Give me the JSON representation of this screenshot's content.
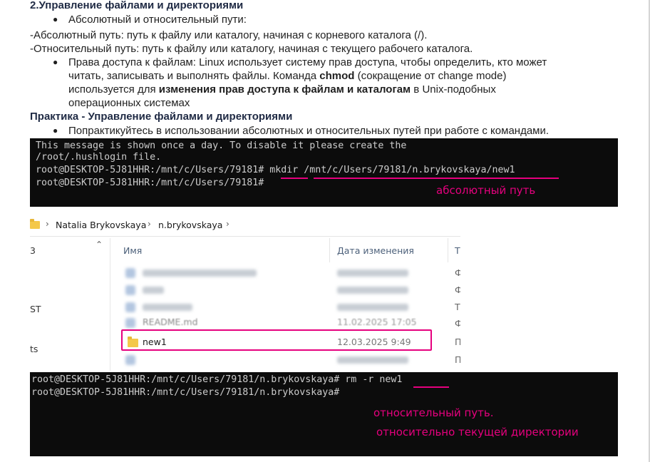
{
  "doc": {
    "h_section": "2.Управление файлами и директориями",
    "b1": "Абсолютный и относительный пути:",
    "p_abs": "-Абсолютный путь: путь к файлу или каталогу, начиная с корневого каталога (/).",
    "p_rel": "-Относительный путь: путь к файлу или каталогу, начиная с текущего рабочего каталога.",
    "b2_line1": "Права доступа к файлам: Linux использует систему прав доступа, чтобы определить, кто может",
    "b2_line2_a": "читать, записывать и выполнять файлы. Команда ",
    "b2_line2_b": "chmod",
    "b2_line2_c": " (сокращение от change mode)",
    "b2_line3_a": "используется для ",
    "b2_line3_b": "изменения прав доступа к файлам и каталогам",
    "b2_line3_c": " в Unix-подобных",
    "b2_line4": "операционных системах",
    "h_practice": "Практика - Управление файлами и директориями",
    "b3": "Попрактикуйтесь в использовании абсолютных и относительных путей при работе с командами.",
    "bullet_glyph": "●"
  },
  "term1": {
    "line1": "This message is shown once a day. To disable it please create the",
    "line2": "/root/.hushlogin file.",
    "line3_prompt": "root@DESKTOP-5J81HHR:/mnt/c/Users/79181# ",
    "line3_cmd": "mkdir",
    "line3_arg": " /mnt/c/Users/79181/n.brykovskaya/new1",
    "line4": "root@DESKTOP-5J81HHR:/mnt/c/Users/79181#",
    "annotation": "абсолютный путь"
  },
  "explorer": {
    "breadcrumb": [
      "Natalia Brykovskaya",
      "n.brykovskaya"
    ],
    "col_name": "Имя",
    "col_date": "Дата изменения",
    "col_type": "Т",
    "left_glyphs": [
      "3",
      "ST",
      "ts"
    ],
    "readme_name": "README.md",
    "readme_date": "11.02.2025 17:05",
    "new1_name": "new1",
    "new1_date": "12.03.2025 9:49",
    "type_glyphs": [
      "Ф",
      "Ф",
      "Т",
      "Ф",
      "П",
      "П"
    ]
  },
  "term2": {
    "line1_prompt": "root@DESKTOP-5J81HHR:/mnt/c/Users/79181/n.brykovskaya# rm -r ",
    "line1_arg": "new1",
    "line2": "root@DESKTOP-5J81HHR:/mnt/c/Users/79181/n.brykovskaya#",
    "annotation1": "относительный путь.",
    "annotation2": "относительно текущей директории"
  },
  "colors": {
    "accent": "#e6007e",
    "terminal_bg": "#0c0c0c",
    "terminal_fg": "#cccccc",
    "folder": "#f4c84a"
  }
}
